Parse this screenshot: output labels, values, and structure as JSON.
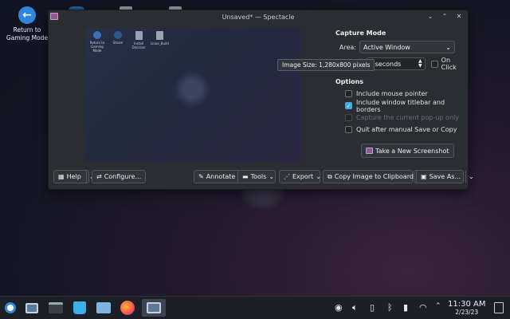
{
  "desktop": {
    "return_icon_label_line1": "Return to",
    "return_icon_label_line2": "Gaming Mode"
  },
  "window": {
    "title": "Unsaved* — Spectacle"
  },
  "preview_icons": [
    {
      "label": "Return to Gaming Mode",
      "icon": "return-icon"
    },
    {
      "label": "Steam",
      "icon": "steam-icon"
    },
    {
      "label": "Install Decision",
      "icon": "file-icon"
    },
    {
      "label": "Linux_Build",
      "icon": "file-icon"
    }
  ],
  "capture": {
    "section_title": "Capture Mode",
    "area_label": "Area:",
    "area_value": "Active Window",
    "delay_value": "3 seconds",
    "on_click_label": "On Click",
    "on_click_checked": false
  },
  "tooltip": "Image Size: 1,280x800 pixels",
  "options": {
    "section_title": "Options",
    "items": [
      {
        "label": "Include mouse pointer",
        "checked": false,
        "disabled": false
      },
      {
        "label": "Include window titlebar and borders",
        "checked": true,
        "disabled": false
      },
      {
        "label": "Capture the current pop-up only",
        "checked": false,
        "disabled": true
      },
      {
        "label": "Quit after manual Save or Copy",
        "checked": false,
        "disabled": false
      }
    ]
  },
  "new_screenshot_label": "Take a New Screenshot",
  "bottom": {
    "help": "Help",
    "configure": "Configure...",
    "annotate": "Annotate",
    "tools": "Tools",
    "export": "Export",
    "copy": "Copy Image to Clipboard",
    "save": "Save As..."
  },
  "clock": {
    "time": "11:30 AM",
    "date": "2/23/23"
  },
  "colors": {
    "accent": "#3daee9",
    "window_bg": "#2a2e32",
    "return_icon": "#2e86de"
  }
}
